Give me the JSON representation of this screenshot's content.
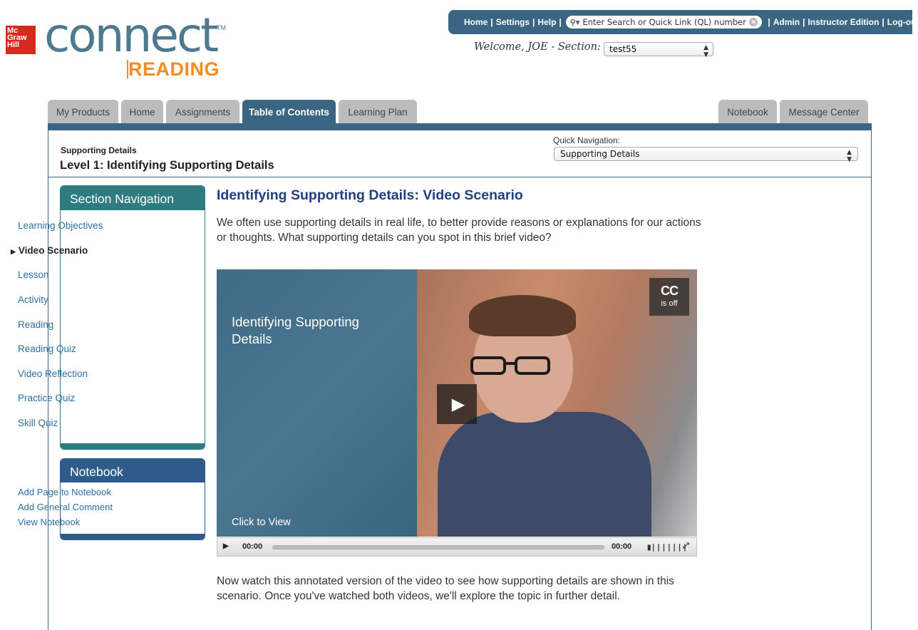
{
  "brand": {
    "badge_lines": [
      "Mc",
      "Graw",
      "Hill"
    ],
    "logo_word": "connect",
    "logo_tm": "TM",
    "logo_product": "READING"
  },
  "top_bar": {
    "links_left": [
      "Home",
      "Settings",
      "Help"
    ],
    "search_placeholder": "Enter Search or Quick Link (QL) number",
    "links_right": [
      "Admin",
      "Instructor Edition",
      "Log-out"
    ]
  },
  "welcome": {
    "text": "Welcome, JOE - Section:",
    "section_value": "test55"
  },
  "tabs": {
    "left": [
      "My Products",
      "Home",
      "Assignments",
      "Table of Contents",
      "Learning Plan"
    ],
    "active": "Table of Contents",
    "right": [
      "Notebook",
      "Message Center"
    ]
  },
  "header": {
    "crumb": "Supporting Details",
    "title": "Level 1: Identifying Supporting Details",
    "quick_nav_label": "Quick Navigation:",
    "quick_nav_value": "Supporting Details"
  },
  "section_nav": {
    "title": "Section Navigation",
    "items": [
      "Learning Objectives",
      "Video Scenario",
      "Lesson",
      "Activity",
      "Reading",
      "Reading Quiz",
      "Video Reflection",
      "Practice Quiz",
      "Skill Quiz"
    ],
    "current": "Video Scenario"
  },
  "notebook": {
    "title": "Notebook",
    "items": [
      "Add Page to Notebook",
      "Add General Comment",
      "View Notebook"
    ]
  },
  "main": {
    "title": "Identifying Supporting Details: Video Scenario",
    "intro": "We often use supporting details in real life, to better provide reasons or explanations for our actions or thoughts. What supporting details can you spot in this brief video?",
    "outro": "Now watch this annotated version of the video to see how supporting details are shown in this scenario. Once you've watched both videos, we'll explore the topic in further detail."
  },
  "video": {
    "title": "Identifying Supporting Details",
    "cta": "Click to View",
    "cc_label": "CC",
    "cc_status": "is off",
    "time_current": "00:00",
    "time_total": "00:00",
    "progress": 0
  },
  "colors": {
    "nav_blue": "#3b6683",
    "section_nav_teal": "#2e7b80",
    "notebook_blue": "#2f5b8a",
    "link_blue": "#2d6ea3",
    "title_navy": "#1f3f7e",
    "brand_orange": "#f08d23",
    "brand_red": "#d52b1e"
  },
  "icons": [
    "search-icon",
    "clear-search-icon",
    "play-icon",
    "closed-caption-icon",
    "volume-icon",
    "fullscreen-icon",
    "dropdown-arrow-icon"
  ]
}
